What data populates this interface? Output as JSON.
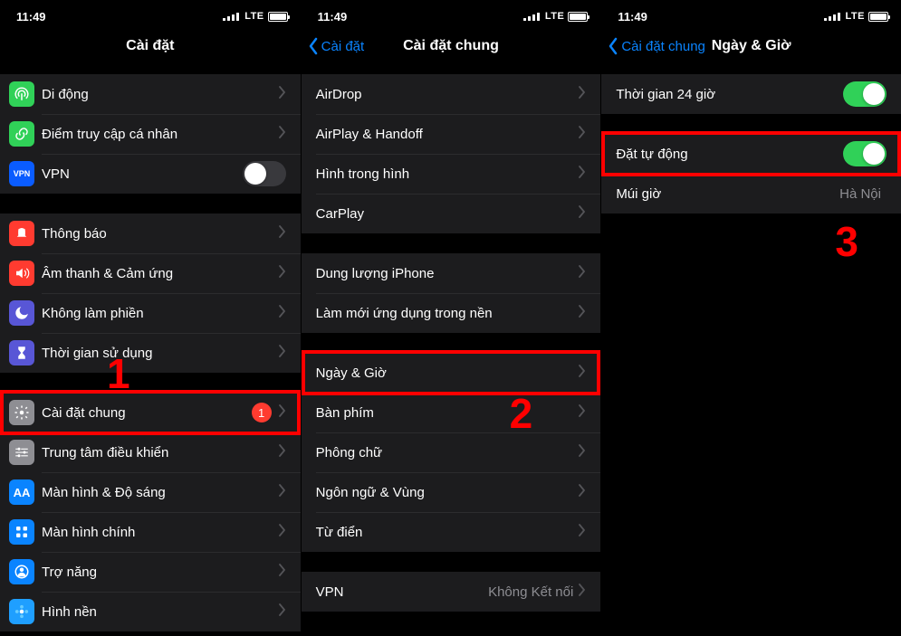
{
  "status": {
    "time": "11:49",
    "carrier": "LTE"
  },
  "pane1": {
    "title": "Cài đặt",
    "step_number": "1",
    "groups": [
      {
        "rows": [
          {
            "key": "cellular",
            "label": "Di động",
            "icon": "antenna",
            "bg": "bg-green"
          },
          {
            "key": "hotspot",
            "label": "Điểm truy cập cá nhân",
            "icon": "link",
            "bg": "bg-green2"
          },
          {
            "key": "vpn",
            "label": "VPN",
            "icon": "vpn",
            "bg": "bg-vpn",
            "toggle": "off"
          }
        ]
      },
      {
        "rows": [
          {
            "key": "notifications",
            "label": "Thông báo",
            "icon": "bell",
            "bg": "bg-red"
          },
          {
            "key": "sounds",
            "label": "Âm thanh & Cảm ứng",
            "icon": "speaker",
            "bg": "bg-red"
          },
          {
            "key": "dnd",
            "label": "Không làm phiền",
            "icon": "moon",
            "bg": "bg-purple"
          },
          {
            "key": "screentime",
            "label": "Thời gian sử dụng",
            "icon": "hourglass",
            "bg": "bg-purple"
          }
        ]
      },
      {
        "rows": [
          {
            "key": "general",
            "label": "Cài đặt chung",
            "icon": "gear",
            "bg": "bg-grey",
            "badge": "1",
            "highlight": true
          },
          {
            "key": "control",
            "label": "Trung tâm điều khiển",
            "icon": "sliders",
            "bg": "bg-grey"
          },
          {
            "key": "display",
            "label": "Màn hình & Độ sáng",
            "icon": "aa",
            "bg": "bg-aa"
          },
          {
            "key": "home",
            "label": "Màn hình chính",
            "icon": "grid",
            "bg": "bg-blue"
          },
          {
            "key": "accessibility",
            "label": "Trợ năng",
            "icon": "person",
            "bg": "bg-blue"
          },
          {
            "key": "wallpaper",
            "label": "Hình nền",
            "icon": "flower",
            "bg": "bg-cyan"
          }
        ]
      }
    ]
  },
  "pane2": {
    "back": "Cài đặt",
    "title": "Cài đặt chung",
    "step_number": "2",
    "groups": [
      {
        "rows": [
          {
            "key": "airdrop",
            "label": "AirDrop"
          },
          {
            "key": "airplay",
            "label": "AirPlay & Handoff"
          },
          {
            "key": "pip",
            "label": "Hình trong hình"
          },
          {
            "key": "carplay",
            "label": "CarPlay"
          }
        ]
      },
      {
        "rows": [
          {
            "key": "storage",
            "label": "Dung lượng iPhone"
          },
          {
            "key": "bgrefresh",
            "label": "Làm mới ứng dụng trong nền"
          }
        ]
      },
      {
        "rows": [
          {
            "key": "datetime",
            "label": "Ngày & Giờ",
            "highlight": true
          },
          {
            "key": "keyboard",
            "label": "Bàn phím"
          },
          {
            "key": "fonts",
            "label": "Phông chữ"
          },
          {
            "key": "language",
            "label": "Ngôn ngữ & Vùng"
          },
          {
            "key": "dict",
            "label": "Từ điển"
          }
        ]
      },
      {
        "rows": [
          {
            "key": "vpnrow",
            "label": "VPN",
            "value": "Không Kết nối"
          }
        ]
      }
    ]
  },
  "pane3": {
    "back": "Cài đặt chung",
    "title": "Ngày & Giờ",
    "step_number": "3",
    "groups": [
      {
        "rows": [
          {
            "key": "24h",
            "label": "Thời gian 24 giờ",
            "toggle": "on"
          }
        ]
      },
      {
        "rows": [
          {
            "key": "auto",
            "label": "Đặt tự động",
            "toggle": "on",
            "highlight": true
          },
          {
            "key": "tz",
            "label": "Múi giờ",
            "value": "Hà Nội",
            "nochev": true
          }
        ]
      }
    ]
  }
}
